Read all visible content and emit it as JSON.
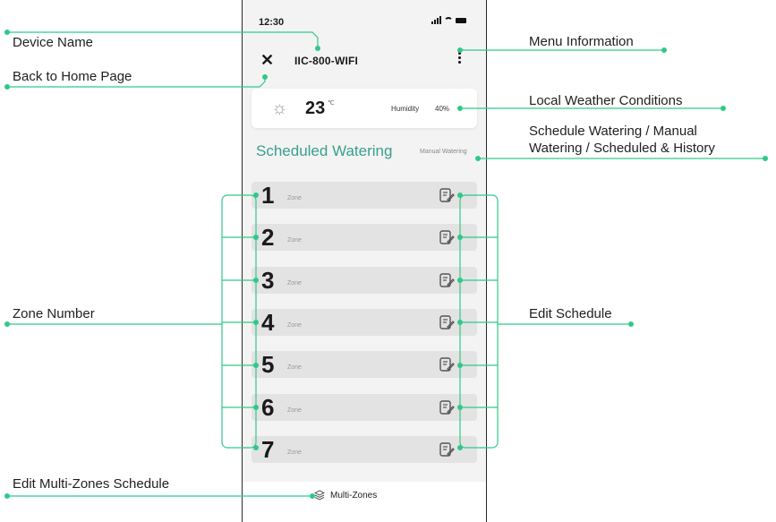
{
  "callouts": {
    "device_name": "Device Name",
    "back_home": "Back to Home Page",
    "menu_info": "Menu Information",
    "weather": "Local Weather Conditions",
    "tabs_line1": "Schedule Watering / Manual",
    "tabs_line2": "Watering / Scheduled & History",
    "zone_number": "Zone Number",
    "edit_schedule": "Edit Schedule",
    "multi_zone_edit": "Edit Multi-Zones Schedule"
  },
  "status_bar": {
    "time": "12:30"
  },
  "header": {
    "close_icon": "✕",
    "device_name": "IIC-800-WIFI"
  },
  "weather": {
    "temperature": "23",
    "unit": "℃",
    "humidity_label": "Humidity",
    "humidity_value": "40%"
  },
  "tabs": {
    "scheduled": "Scheduled Watering",
    "manual": "Manual Watering"
  },
  "zones": [
    {
      "number": "1",
      "label": "Zone"
    },
    {
      "number": "2",
      "label": "Zone"
    },
    {
      "number": "3",
      "label": "Zone"
    },
    {
      "number": "4",
      "label": "Zone"
    },
    {
      "number": "5",
      "label": "Zone"
    },
    {
      "number": "6",
      "label": "Zone"
    },
    {
      "number": "7",
      "label": "Zone"
    }
  ],
  "footer": {
    "multi_zones": "Multi-Zones"
  },
  "colors": {
    "accent": "#2ec98a",
    "tab_active": "#39a08b"
  },
  "icons": [
    "sun-icon",
    "close-icon",
    "kebab-menu-icon",
    "edit-note-icon",
    "layers-icon"
  ]
}
